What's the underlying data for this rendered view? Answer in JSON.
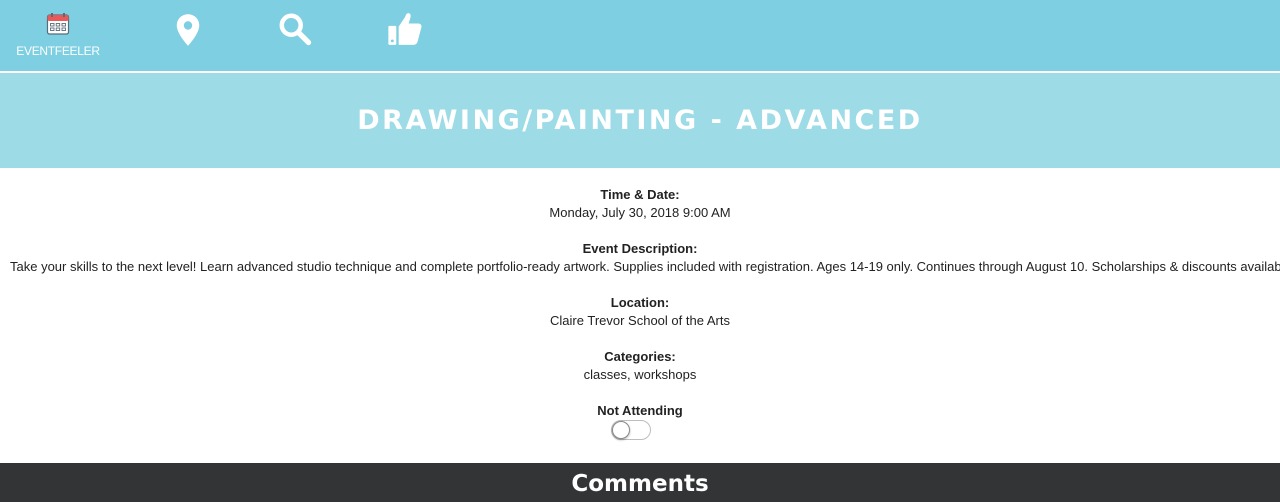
{
  "nav": {
    "brand_label": "EVENTFEELER",
    "brand_icon": "calendar-icon",
    "items": [
      {
        "icon": "map-pin-icon"
      },
      {
        "icon": "search-icon"
      },
      {
        "icon": "thumbs-up-icon"
      }
    ],
    "colors": {
      "bar": "#7ecfe2",
      "icon": "#ffffff",
      "calendar_accent": "#e85a5a"
    }
  },
  "event": {
    "title": "DRAWING/PAINTING - ADVANCED",
    "time_label": "Time & Date:",
    "time_value": "Monday, July 30, 2018 9:00 AM",
    "description_label": "Event Description:",
    "description_value": "Take your skills to the next level! Learn advanced studio technique and complete portfolio-ready artwork. Supplies included with registration. Ages 14-19 only. Continues through August 10. Scholarships & discounts available.",
    "location_label": "Location:",
    "location_value": "Claire Trevor School of the Arts",
    "categories_label": "Categories:",
    "categories_value": "classes, workshops",
    "attendance_label": "Not Attending",
    "attending": false
  },
  "comments": {
    "title": "Comments"
  },
  "colors": {
    "hero": "#9ddbe7",
    "comments_bar": "#333436"
  }
}
